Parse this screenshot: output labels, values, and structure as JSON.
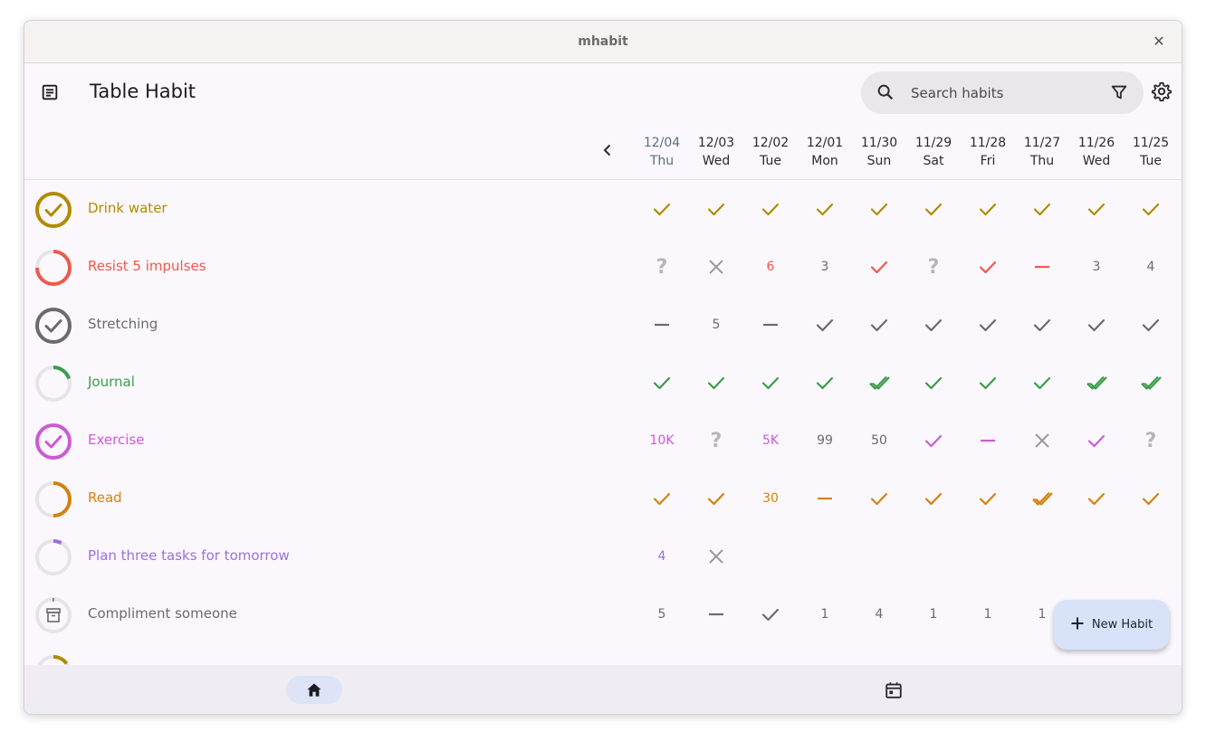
{
  "window": {
    "title": "mhabit",
    "close_icon": "close-icon"
  },
  "appbar": {
    "title": "Table Habit",
    "menu_icon": "notes-icon",
    "settings_icon": "gear-icon"
  },
  "search": {
    "placeholder": "Search habits",
    "value": "",
    "search_icon": "search-icon",
    "filter_icon": "filter-icon"
  },
  "dates": [
    {
      "date": "12/04",
      "day": "Thu"
    },
    {
      "date": "12/03",
      "day": "Wed"
    },
    {
      "date": "12/02",
      "day": "Tue"
    },
    {
      "date": "12/01",
      "day": "Mon"
    },
    {
      "date": "11/30",
      "day": "Sun"
    },
    {
      "date": "11/29",
      "day": "Sat"
    },
    {
      "date": "11/28",
      "day": "Fri"
    },
    {
      "date": "11/27",
      "day": "Thu"
    },
    {
      "date": "11/26",
      "day": "Wed"
    },
    {
      "date": "11/25",
      "day": "Tue"
    }
  ],
  "habits": [
    {
      "name": "Drink water",
      "color": "#b08c00",
      "ring": "check",
      "progress": 1.0,
      "cells": [
        "check",
        "check",
        "check",
        "check",
        "check",
        "check",
        "check",
        "check",
        "check",
        "check"
      ]
    },
    {
      "name": "Resist 5 impulses",
      "color": "#ec5a4c",
      "ring": "progress",
      "progress": 0.75,
      "cells": [
        "?",
        "x",
        "6",
        "3",
        "check",
        "?",
        "check",
        "dash",
        "3",
        "4"
      ]
    },
    {
      "name": "Stretching",
      "color": "#6b6a70",
      "ring": "check",
      "progress": 1.0,
      "cells": [
        "dash",
        "5",
        "dash",
        "check",
        "check",
        "check",
        "check",
        "check",
        "check",
        "check"
      ]
    },
    {
      "name": "Journal",
      "color": "#3a9e4a",
      "ring": "progress",
      "progress": 0.2,
      "cells": [
        "check",
        "check",
        "check",
        "check",
        "dcheck",
        "check",
        "check",
        "check",
        "dcheck",
        "dcheck"
      ]
    },
    {
      "name": "Exercise",
      "color": "#cc5ad6",
      "ring": "check",
      "progress": 1.0,
      "cells": [
        "10K",
        "?",
        "5K",
        "99",
        "50",
        "check",
        "dash",
        "x",
        "check",
        "?"
      ]
    },
    {
      "name": "Read",
      "color": "#d4820c",
      "ring": "progress",
      "progress": 0.5,
      "cells": [
        "check",
        "check",
        "30",
        "dash",
        "check",
        "check",
        "check",
        "dcheck",
        "check",
        "check"
      ]
    },
    {
      "name": "Plan three tasks for tomorrow",
      "color": "#9a70dc",
      "ring": "progress",
      "progress": 0.08,
      "cells": [
        "4",
        "x",
        "",
        "",
        "",
        "",
        "",
        "",
        "",
        ""
      ]
    },
    {
      "name": "Compliment someone",
      "color": "#6b6a70",
      "ring": "archive",
      "progress": 0.0,
      "cells": [
        "5",
        "dash",
        "check",
        "1",
        "4",
        "1",
        "1",
        "1",
        "",
        ""
      ]
    },
    {
      "name": "",
      "color": "#b08c00",
      "ring": "progress",
      "progress": 0.15,
      "cells": []
    }
  ],
  "cell_colors": {
    "neutral_number": "#6b6a70",
    "unknown": "#b8b6bc",
    "skip": "#9a98a0"
  },
  "fab": {
    "label": "New Habit",
    "icon": "plus-icon"
  },
  "nav": {
    "home_icon": "home-icon",
    "calendar_icon": "calendar-icon"
  }
}
